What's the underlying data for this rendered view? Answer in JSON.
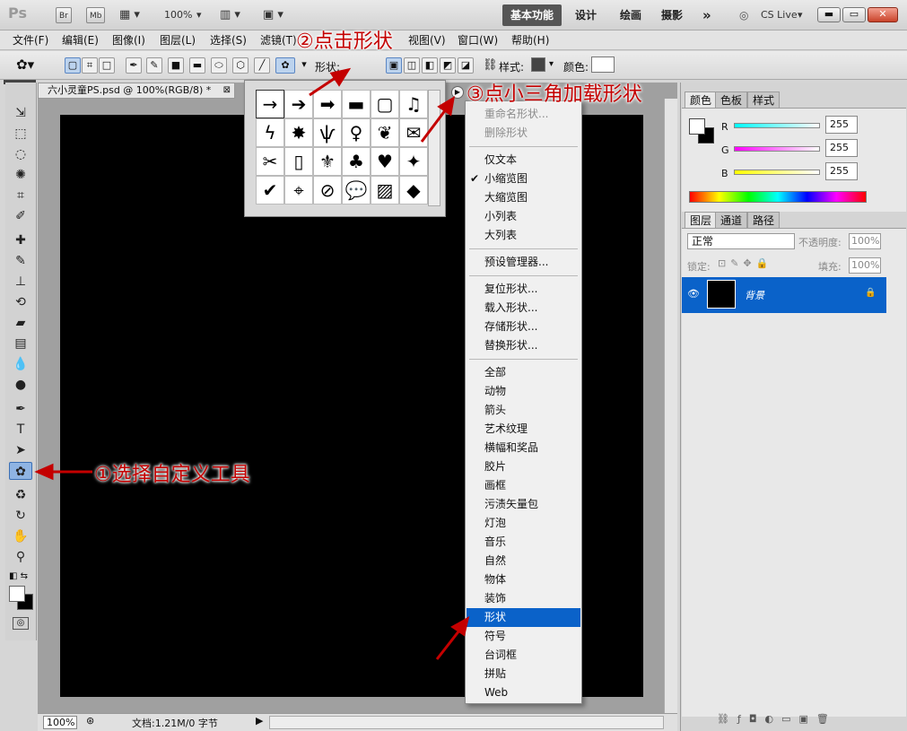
{
  "app": {
    "logo": "Ps",
    "bridge_label": "Br",
    "minibridge_label": "Mb",
    "zoom": "100%",
    "workspaces": [
      "基本功能",
      "设计",
      "绘画",
      "摄影"
    ],
    "more_label": "»",
    "cs_live": "CS Live"
  },
  "menubar": {
    "items": [
      "文件(F)",
      "编辑(E)",
      "图像(I)",
      "图层(L)",
      "选择(S)",
      "滤镜(T)",
      "视图(V)",
      "窗口(W)",
      "帮助(H)"
    ]
  },
  "options": {
    "shape_label": "形状:",
    "style_label": "样式:",
    "color_label": "颜色:"
  },
  "document": {
    "tab_title": "六小灵童PS.psd @ 100%(RGB/8) *",
    "zoom_field": "100%",
    "status": "文档:1.21M/0 字节"
  },
  "shape_picker": {
    "shapes": [
      "→",
      "➔",
      "➡",
      "▬",
      "▢",
      "♫",
      "ϟ",
      "✸",
      "ѱ",
      "♀",
      "❦",
      "✉",
      "✂",
      "▯",
      "⚜",
      "♣",
      "♥",
      "✦",
      "✔",
      "⌖",
      "⊘",
      "💬",
      "▨",
      "◆"
    ]
  },
  "flyout": {
    "disabled": [
      "重命名形状...",
      "删除形状"
    ],
    "views": [
      "仅文本",
      "小缩览图",
      "大缩览图",
      "小列表",
      "大列表"
    ],
    "checked_view": "小缩览图",
    "manager": "预设管理器...",
    "actions": [
      "复位形状...",
      "载入形状...",
      "存储形状...",
      "替换形状..."
    ],
    "libraries": [
      "全部",
      "动物",
      "箭头",
      "艺术纹理",
      "横幅和奖品",
      "胶片",
      "画框",
      "污渍矢量包",
      "灯泡",
      "音乐",
      "自然",
      "物体",
      "装饰",
      "形状",
      "符号",
      "台词框",
      "拼贴",
      "Web"
    ],
    "selected_library": "形状"
  },
  "panels": {
    "color_tabs": [
      "颜色",
      "色板",
      "样式"
    ],
    "rgb": [
      {
        "label": "R",
        "value": "255"
      },
      {
        "label": "G",
        "value": "255"
      },
      {
        "label": "B",
        "value": "255"
      }
    ],
    "layer_tabs": [
      "图层",
      "通道",
      "路径"
    ],
    "blend_mode": "正常",
    "opacity_label": "不透明度:",
    "opacity_value": "100%",
    "lock_label": "锁定:",
    "fill_label": "填充:",
    "fill_value": "100%",
    "layer_name": "背景"
  },
  "annotations": {
    "step1": "①选择自定义工具",
    "step2": "②点击形状",
    "step3": "③点小三角加载形状"
  },
  "colors": {
    "annotation": "#c40000",
    "selection": "#0a62c9",
    "canvas": "#000000"
  }
}
